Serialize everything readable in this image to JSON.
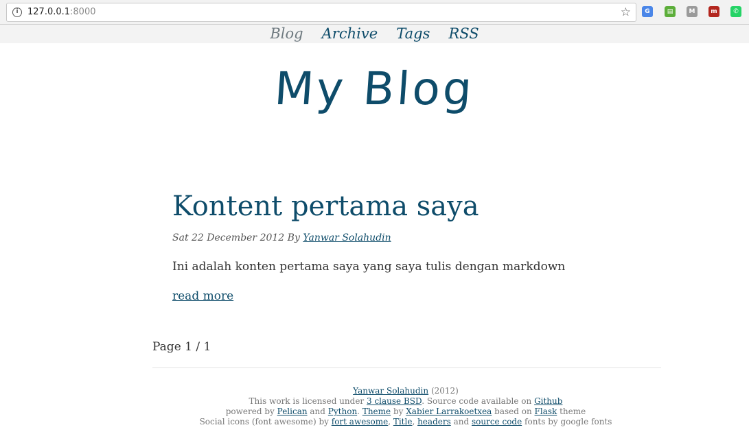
{
  "browser": {
    "url_host": "127.0.0.1",
    "url_port": ":8000",
    "extensions": [
      {
        "name": "google-translate-icon",
        "color": "#4a86e8",
        "glyph": "G"
      },
      {
        "name": "printer-icon",
        "color": "#5cae3a",
        "glyph": "▤"
      },
      {
        "name": "m-extension-icon",
        "color": "#9a9a9a",
        "glyph": "M"
      },
      {
        "name": "red-extension-icon",
        "color": "#b3261e",
        "glyph": "m"
      },
      {
        "name": "whatsapp-icon",
        "color": "#25d366",
        "glyph": "✆"
      }
    ]
  },
  "nav": {
    "items": [
      "Blog",
      "Archive",
      "Tags",
      "RSS"
    ]
  },
  "site": {
    "logo": "My Blog"
  },
  "post": {
    "title": "Kontent pertama saya",
    "date": "Sat 22 December 2012",
    "by": "By",
    "author": "Yanwar Solahudin",
    "summary": "Ini adalah konten pertama saya yang saya tulis dengan markdown",
    "read_more": "read more"
  },
  "pagination": {
    "text": "Page 1 / 1"
  },
  "footer": {
    "author": "Yanwar Solahudin",
    "year": "(2012)",
    "license_pre": "This work is licensed under",
    "license_link": "3 clause BSD",
    "source_pre": ". Source code available on",
    "github": "Github",
    "powered_by": "powered by",
    "pelican": "Pelican",
    "and": "and",
    "python": "Python",
    "theme": "Theme",
    "by": "by",
    "theme_author": "Xabier Larrakoetxea",
    "based_on": "based on",
    "flask": "Flask",
    "theme_word": "theme",
    "social_pre": "Social icons (font awesome) by",
    "fort_awesome": "fort awesome",
    "title_link": "Title",
    "headers_link": "headers",
    "source_code": "source code",
    "fonts_post": "fonts by google fonts"
  }
}
